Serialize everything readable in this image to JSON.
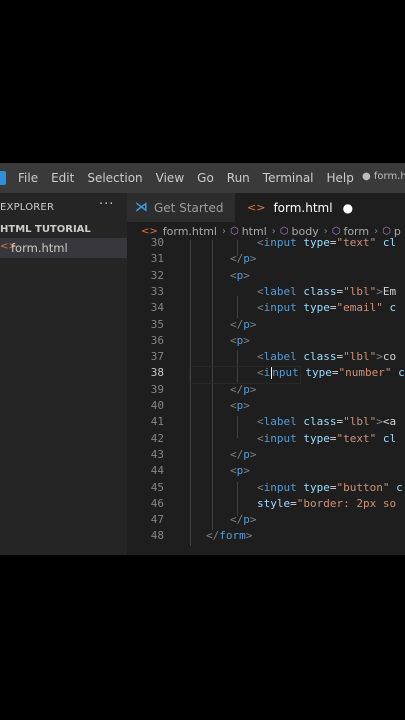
{
  "menu": {
    "items": [
      "File",
      "Edit",
      "Selection",
      "View",
      "Go",
      "Run",
      "Terminal",
      "Help"
    ],
    "window_title": "● form.html"
  },
  "sidebar": {
    "header": "EXPLORER",
    "more": "···",
    "section": "HTML TUTORIAL",
    "file": "form.html"
  },
  "tabs": [
    {
      "label": "Get Started",
      "active": false
    },
    {
      "label": "form.html",
      "active": true,
      "dirty_marker": "●"
    }
  ],
  "breadcrumb": [
    "form.html",
    "html",
    "body",
    "form",
    "p"
  ],
  "editor": {
    "current_line": 38,
    "lines": [
      {
        "n": "30",
        "indent": 3,
        "tokens": [
          [
            "p",
            "<"
          ],
          [
            "t",
            "input"
          ],
          [
            "x",
            " "
          ],
          [
            "a",
            "type"
          ],
          [
            "x",
            "="
          ],
          [
            "s",
            "\"text\""
          ],
          [
            "x",
            " "
          ],
          [
            "a",
            "cl"
          ]
        ]
      },
      {
        "n": "31",
        "indent": 2,
        "tokens": [
          [
            "p",
            "</"
          ],
          [
            "t",
            "p"
          ],
          [
            "p",
            ">"
          ]
        ]
      },
      {
        "n": "32",
        "indent": 2,
        "tokens": [
          [
            "p",
            "<"
          ],
          [
            "t",
            "p"
          ],
          [
            "p",
            ">"
          ]
        ]
      },
      {
        "n": "33",
        "indent": 3,
        "tokens": [
          [
            "p",
            "<"
          ],
          [
            "t",
            "label"
          ],
          [
            "x",
            " "
          ],
          [
            "a",
            "class"
          ],
          [
            "x",
            "="
          ],
          [
            "s",
            "\"lbl\""
          ],
          [
            "p",
            ">"
          ],
          [
            "x",
            "Em"
          ]
        ]
      },
      {
        "n": "34",
        "indent": 3,
        "tokens": [
          [
            "p",
            "<"
          ],
          [
            "t",
            "input"
          ],
          [
            "x",
            " "
          ],
          [
            "a",
            "type"
          ],
          [
            "x",
            "="
          ],
          [
            "s",
            "\"email\""
          ],
          [
            "x",
            " "
          ],
          [
            "a",
            "c"
          ]
        ]
      },
      {
        "n": "35",
        "indent": 2,
        "tokens": [
          [
            "p",
            "</"
          ],
          [
            "t",
            "p"
          ],
          [
            "p",
            ">"
          ]
        ]
      },
      {
        "n": "36",
        "indent": 2,
        "tokens": [
          [
            "p",
            "<"
          ],
          [
            "t",
            "p"
          ],
          [
            "p",
            ">"
          ]
        ]
      },
      {
        "n": "37",
        "indent": 3,
        "tokens": [
          [
            "p",
            "<"
          ],
          [
            "t",
            "label"
          ],
          [
            "x",
            " "
          ],
          [
            "a",
            "class"
          ],
          [
            "x",
            "="
          ],
          [
            "s",
            "\"lbl\""
          ],
          [
            "p",
            ">"
          ],
          [
            "x",
            "co"
          ]
        ]
      },
      {
        "n": "38",
        "indent": 3,
        "tokens": [
          [
            "p",
            "<"
          ],
          [
            "t",
            "i"
          ],
          [
            "caret",
            ""
          ],
          [
            "t",
            "nput"
          ],
          [
            "x",
            " "
          ],
          [
            "a",
            "type"
          ],
          [
            "x",
            "="
          ],
          [
            "s",
            "\"number\""
          ],
          [
            "x",
            " "
          ],
          [
            "a",
            "c"
          ]
        ]
      },
      {
        "n": "39",
        "indent": 2,
        "tokens": [
          [
            "p",
            "</"
          ],
          [
            "t",
            "p"
          ],
          [
            "p",
            ">"
          ]
        ]
      },
      {
        "n": "40",
        "indent": 2,
        "tokens": [
          [
            "p",
            "<"
          ],
          [
            "t",
            "p"
          ],
          [
            "p",
            ">"
          ]
        ]
      },
      {
        "n": "41",
        "indent": 3,
        "tokens": [
          [
            "p",
            "<"
          ],
          [
            "t",
            "label"
          ],
          [
            "x",
            " "
          ],
          [
            "a",
            "class"
          ],
          [
            "x",
            "="
          ],
          [
            "s",
            "\"lbl\""
          ],
          [
            "p",
            ">"
          ],
          [
            "x",
            "<a"
          ]
        ]
      },
      {
        "n": "42",
        "indent": 3,
        "tokens": [
          [
            "p",
            "<"
          ],
          [
            "t",
            "input"
          ],
          [
            "x",
            " "
          ],
          [
            "a",
            "type"
          ],
          [
            "x",
            "="
          ],
          [
            "s",
            "\"text\""
          ],
          [
            "x",
            " "
          ],
          [
            "a",
            "cl"
          ]
        ]
      },
      {
        "n": "43",
        "indent": 2,
        "tokens": [
          [
            "p",
            "</"
          ],
          [
            "t",
            "p"
          ],
          [
            "p",
            ">"
          ]
        ]
      },
      {
        "n": "44",
        "indent": 2,
        "tokens": [
          [
            "p",
            "<"
          ],
          [
            "t",
            "p"
          ],
          [
            "p",
            ">"
          ]
        ]
      },
      {
        "n": "45",
        "indent": 3,
        "tokens": [
          [
            "p",
            "<"
          ],
          [
            "t",
            "input"
          ],
          [
            "x",
            " "
          ],
          [
            "a",
            "type"
          ],
          [
            "x",
            "="
          ],
          [
            "s",
            "\"button\""
          ],
          [
            "x",
            " "
          ],
          [
            "a",
            "c"
          ]
        ]
      },
      {
        "n": "46",
        "indent": 3,
        "tokens": [
          [
            "a",
            "style"
          ],
          [
            "x",
            "="
          ],
          [
            "s",
            "\"border: 2px so"
          ]
        ]
      },
      {
        "n": "47",
        "indent": 2,
        "tokens": [
          [
            "p",
            "</"
          ],
          [
            "t",
            "p"
          ],
          [
            "p",
            ">"
          ]
        ]
      },
      {
        "n": "48",
        "indent": 1,
        "tokens": [
          [
            "p",
            "</"
          ],
          [
            "t",
            "form"
          ],
          [
            "p",
            ">"
          ]
        ]
      }
    ]
  }
}
